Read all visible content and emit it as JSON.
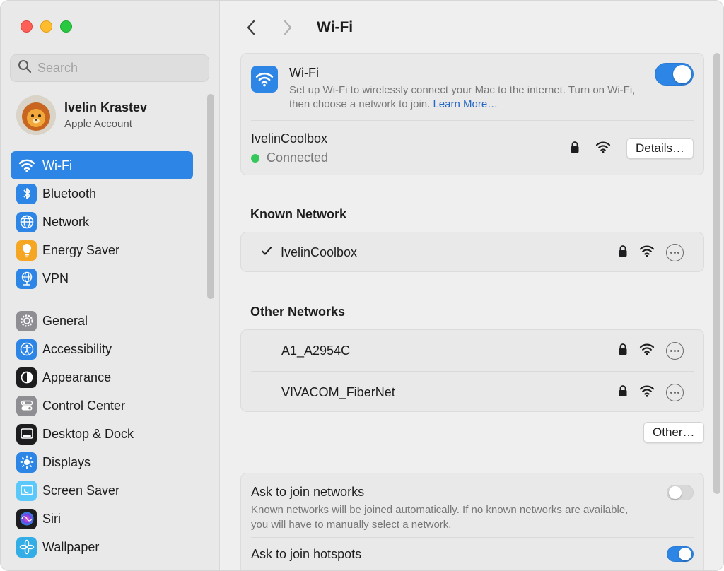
{
  "window": {
    "traffic_lights": [
      "close",
      "minimize",
      "zoom"
    ]
  },
  "sidebar": {
    "search": {
      "placeholder": "Search",
      "value": ""
    },
    "account": {
      "name": "Ivelin Krastev",
      "subtitle": "Apple Account",
      "avatar_icon": "lion-avatar-icon"
    },
    "items": [
      {
        "label": "Wi-Fi",
        "icon": "wifi-icon",
        "color": "#2d86e6",
        "active": true
      },
      {
        "label": "Bluetooth",
        "icon": "bluetooth-icon",
        "color": "#2d86e6"
      },
      {
        "label": "Network",
        "icon": "globe-icon",
        "color": "#2d86e6"
      },
      {
        "label": "Energy Saver",
        "icon": "lightbulb-icon",
        "color": "#f5a623"
      },
      {
        "label": "VPN",
        "icon": "vpn-globe-icon",
        "color": "#2d86e6"
      },
      {
        "label": "General",
        "icon": "gear-icon",
        "color": "#8e8e93"
      },
      {
        "label": "Accessibility",
        "icon": "accessibility-icon",
        "color": "#2d86e6"
      },
      {
        "label": "Appearance",
        "icon": "appearance-icon",
        "color": "#1d1d1f"
      },
      {
        "label": "Control Center",
        "icon": "control-center-icon",
        "color": "#8e8e93"
      },
      {
        "label": "Desktop & Dock",
        "icon": "dock-icon",
        "color": "#1d1d1f"
      },
      {
        "label": "Displays",
        "icon": "sun-icon",
        "color": "#2d86e6"
      },
      {
        "label": "Screen Saver",
        "icon": "screen-saver-icon",
        "color": "#5ac8fa"
      },
      {
        "label": "Siri",
        "icon": "siri-icon",
        "color": "#7b3fe4"
      },
      {
        "label": "Wallpaper",
        "icon": "flower-icon",
        "color": "#32ade6"
      }
    ]
  },
  "header": {
    "back_icon": "chevron-left-icon",
    "forward_icon": "chevron-right-icon",
    "title": "Wi-Fi"
  },
  "wifi_card": {
    "title": "Wi-Fi",
    "description": "Set up Wi-Fi to wirelessly connect your Mac to the internet. Turn on Wi-Fi, then choose a network to join.",
    "learn_more": "Learn More…",
    "enabled": true,
    "current_network": {
      "name": "IvelinCoolbox",
      "status": "Connected",
      "status_color": "#34c759",
      "details_label": "Details…"
    }
  },
  "known_networks": {
    "title": "Known Network",
    "items": [
      {
        "name": "IvelinCoolbox",
        "checked": true,
        "locked": true
      }
    ]
  },
  "other_networks": {
    "title": "Other Networks",
    "items": [
      {
        "name": "A1_A2954C",
        "locked": true
      },
      {
        "name": "VIVACOM_FiberNet",
        "locked": true
      }
    ],
    "other_button": "Other…"
  },
  "settings": {
    "ask_join_networks": {
      "label": "Ask to join networks",
      "description": "Known networks will be joined automatically. If no known networks are available, you will have to manually select a network.",
      "enabled": false
    },
    "ask_join_hotspots": {
      "label": "Ask to join hotspots",
      "enabled": true
    }
  },
  "colors": {
    "accent": "#2d86e6",
    "link": "#2466c4"
  }
}
